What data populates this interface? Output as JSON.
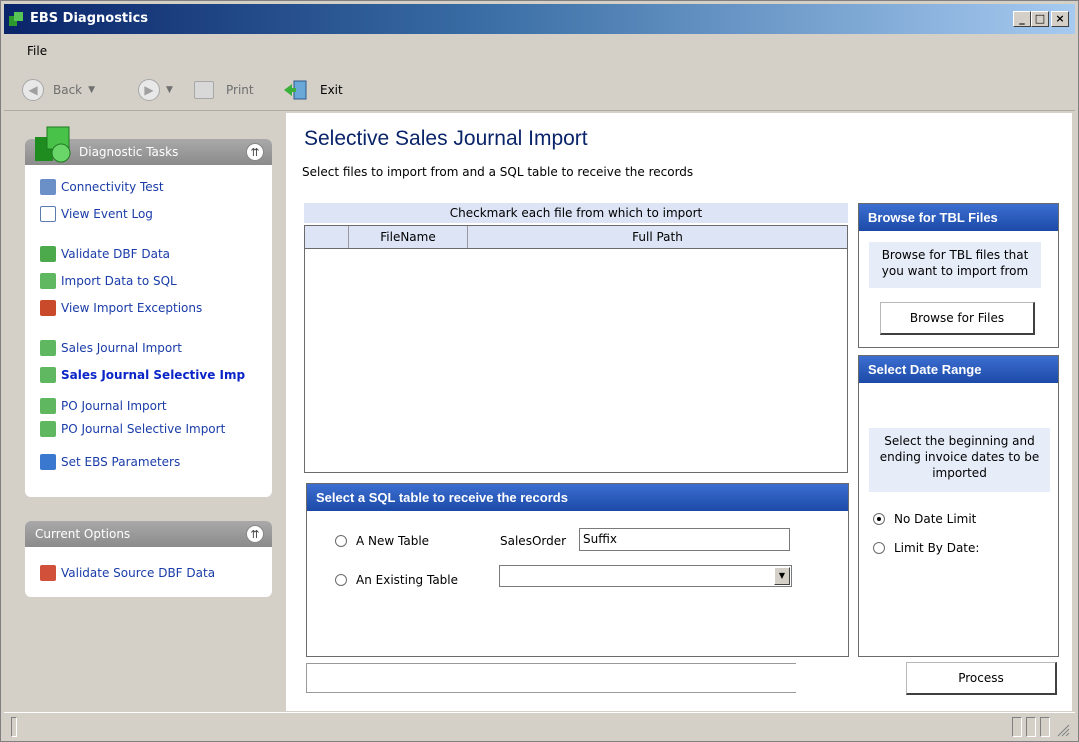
{
  "window": {
    "title": "EBS Diagnostics",
    "controls": {
      "minimize": "_",
      "maximize": "□",
      "close": "×"
    }
  },
  "menu": {
    "file": "File"
  },
  "toolbar": {
    "back_label": "Back",
    "print_label": "Print",
    "exit_label": "Exit"
  },
  "tasks_panel": {
    "title": "Diagnostic Tasks",
    "items": [
      {
        "label": "Connectivity Test",
        "icon": "network-icon"
      },
      {
        "label": "View Event Log",
        "icon": "event-log-icon"
      },
      {
        "label": "Validate DBF Data",
        "icon": "validate-icon"
      },
      {
        "label": "Import Data to SQL",
        "icon": "import-icon"
      },
      {
        "label": "View Import Exceptions",
        "icon": "exceptions-icon"
      },
      {
        "label": "Sales Journal Import",
        "icon": "import-icon"
      },
      {
        "label": "Sales Journal Selective Imp",
        "icon": "import-icon"
      },
      {
        "label": "PO Journal Import",
        "icon": "import-icon"
      },
      {
        "label": "PO Journal Selective Import",
        "icon": "import-icon"
      },
      {
        "label": "Set EBS Parameters",
        "icon": "parameters-icon"
      }
    ]
  },
  "options_panel": {
    "title": "Current Options",
    "items": [
      {
        "label": "Validate Source DBF Data",
        "icon": "validate-source-icon"
      }
    ]
  },
  "main": {
    "title": "Selective Sales Journal Import",
    "subtitle": "Select files to import from and a SQL table to receive the records",
    "grid": {
      "caption": "Checkmark each file from which to import",
      "columns": [
        "",
        "FileName",
        "Full Path"
      ]
    },
    "sql_table": {
      "header": "Select a SQL table to receive the records",
      "new_table_label": "A New Table",
      "new_table_prefix": "SalesOrder",
      "new_table_suffix": "Suffix",
      "existing_table_label": "An Existing Table",
      "existing_table_value": ""
    },
    "browse": {
      "header": "Browse for TBL Files",
      "description": "Browse for TBL files that you want to import from",
      "button_label": "Browse for Files"
    },
    "date_range": {
      "header": "Select Date Range",
      "description": "Select the beginning and ending invoice dates to be imported",
      "no_limit_label": "No Date Limit",
      "limit_label": "Limit By Date:",
      "selected": "No Date Limit"
    },
    "process_button_label": "Process"
  },
  "colors": {
    "title_bar_start": "#0a246a",
    "group_header": "#2855b8",
    "link": "#1a3ca8"
  }
}
